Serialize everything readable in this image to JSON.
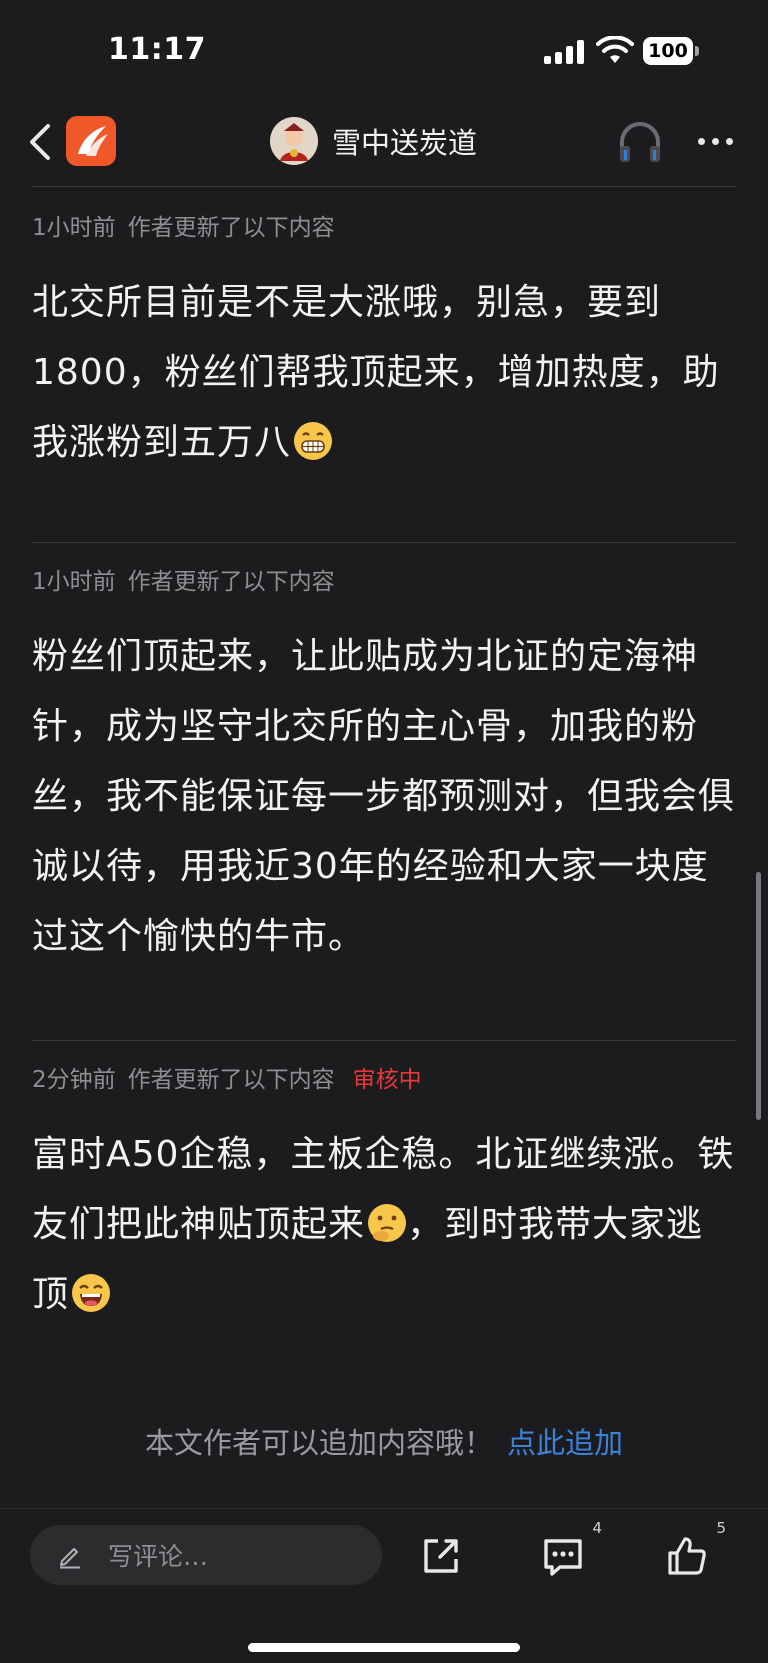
{
  "status_bar": {
    "time": "11:17",
    "battery": "100"
  },
  "nav": {
    "title": "雪中送炭道"
  },
  "updates": [
    {
      "time": "1小时前",
      "label": "作者更新了以下内容",
      "badge": "",
      "text": "北交所目前是不是大涨哦，别急，要到1800，粉丝们帮我顶起来，增加热度，助我涨粉到五万八",
      "emoji": "grinning-teeth-emoji"
    },
    {
      "time": "1小时前",
      "label": "作者更新了以下内容",
      "badge": "",
      "text": "粉丝们顶起来，让此贴成为北证的定海神针，成为坚守北交所的主心骨，加我的粉丝，我不能保证每一步都预测对，但我会俱诚以待，用我近30年的经验和大家一块度过这个愉快的牛市。",
      "emoji": ""
    },
    {
      "time": "2分钟前",
      "label": "作者更新了以下内容",
      "badge": "审核中",
      "text_a": "富时A50企稳，主板企稳。北证继续涨。铁友们把此神贴顶起来",
      "text_b": "，到时我带大家逃顶",
      "emoji_a": "thinking-emoji",
      "emoji_b": "laughing-emoji"
    }
  ],
  "append": {
    "prompt": "本文作者可以追加内容哦！",
    "link": "点此追加"
  },
  "bottom_bar": {
    "comment_placeholder": "写评论…",
    "comment_count": "4",
    "like_count": "5"
  },
  "colors": {
    "background": "#1c1c1e",
    "accent_link": "#3b82d9",
    "review_red": "#e5383b",
    "logo_orange": "#f0582a"
  }
}
